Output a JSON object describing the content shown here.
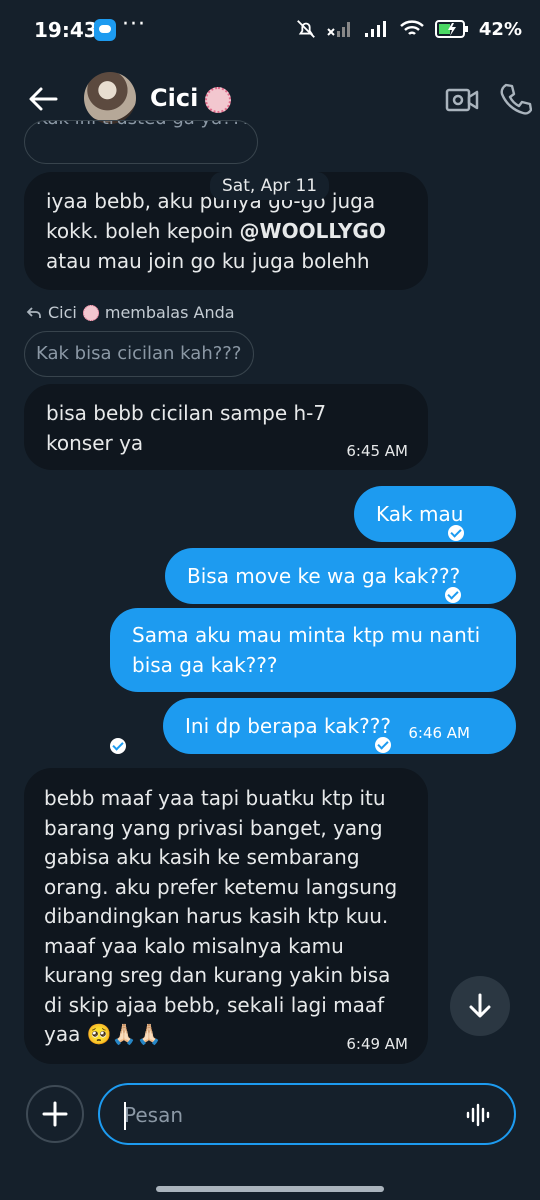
{
  "status_bar": {
    "time": "19:43",
    "dots": "···",
    "battery": "42%"
  },
  "header": {
    "contact_name": "Cici",
    "back_icon": "arrow-left-icon",
    "video_icon": "video-camera-icon",
    "call_icon": "phone-icon"
  },
  "date_separator": "Sat, Apr 11",
  "messages": [
    {
      "quoted_partial": "Kak ini trusted ga ya???",
      "lines": [
        "iyaa bebb, aku punya go-go juga",
        "kokk. boleh kepoin @WOOLLYGO",
        "atau mau join go ku juga bolehh"
      ],
      "line1": "iyaa bebb, aku punya go-go juga",
      "line2_pre": "kokk. boleh kepoin ",
      "line2_mention": "@WOOLLYGO",
      "line3": "atau mau join go ku juga bolehh"
    },
    {
      "reply_header_name": "Cici",
      "reply_header_text": "membalas Anda",
      "quoted": "Kak bisa cicilan kah???",
      "line1": "bisa bebb cicilan sampe h-7",
      "line2": "konser ya",
      "time": "6:45 AM"
    },
    {
      "text": "Kak mau"
    },
    {
      "text": "Bisa move ke wa ga kak???"
    },
    {
      "line1": "Sama aku mau minta ktp mu nanti",
      "line2": "bisa ga kak???"
    },
    {
      "text": "Ini dp berapa kak???",
      "time": "6:46 AM"
    },
    {
      "lines": [
        "bebb maaf yaa tapi buatku ktp itu",
        "barang yang privasi banget, yang",
        "gabisa aku kasih ke sembarang",
        "orang. aku prefer ketemu langsung",
        "dibandingkan harus kasih ktp kuu.",
        "maaf yaa kalo misalnya kamu",
        "kurang sreg dan kurang yakin bisa",
        "di skip ajaa bebb, sekali lagi maaf",
        "yaa 🥺🙏🏻🙏🏻"
      ],
      "time": "6:49 AM"
    }
  ],
  "composer": {
    "placeholder": "Pesan",
    "plus_icon": "plus-icon",
    "voice_icon": "voice-wave-icon"
  },
  "colors": {
    "background": "#15202b",
    "incoming_bubble": "#0f161e",
    "outgoing_bubble": "#1d9bf0"
  }
}
